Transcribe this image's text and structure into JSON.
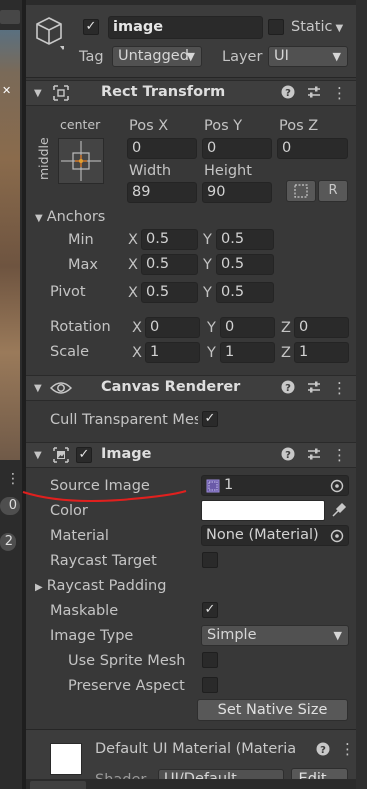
{
  "header": {
    "object_name": "image",
    "static_label": "Static",
    "tag_label": "Tag",
    "tag_value": "Untagged",
    "layer_label": "Layer",
    "layer_value": "UI"
  },
  "rect_transform": {
    "title": "Rect Transform",
    "anchor_preset_h": "center",
    "anchor_preset_v": "middle",
    "pos_x_label": "Pos X",
    "pos_y_label": "Pos Y",
    "pos_z_label": "Pos Z",
    "pos_x": "0",
    "pos_y": "0",
    "pos_z": "0",
    "width_label": "Width",
    "height_label": "Height",
    "width": "89",
    "height": "90",
    "raw_label": "R",
    "anchors_label": "Anchors",
    "min_label": "Min",
    "max_label": "Max",
    "pivot_label": "Pivot",
    "x_label": "X",
    "y_label": "Y",
    "z_label": "Z",
    "min_x": "0.5",
    "min_y": "0.5",
    "max_x": "0.5",
    "max_y": "0.5",
    "pivot_x": "0.5",
    "pivot_y": "0.5",
    "rotation_label": "Rotation",
    "rot_x": "0",
    "rot_y": "0",
    "rot_z": "0",
    "scale_label": "Scale",
    "scale_x": "1",
    "scale_y": "1",
    "scale_z": "1"
  },
  "canvas_renderer": {
    "title": "Canvas Renderer",
    "cull_label": "Cull Transparent Mes",
    "cull_checked": true
  },
  "image": {
    "title": "Image",
    "source_image_label": "Source Image",
    "source_image_value": "1",
    "color_label": "Color",
    "color_value": "#ffffff",
    "material_label": "Material",
    "material_value": "None (Material)",
    "raycast_target_label": "Raycast Target",
    "raycast_padding_label": "Raycast Padding",
    "maskable_label": "Maskable",
    "image_type_label": "Image Type",
    "image_type_value": "Simple",
    "use_sprite_mesh_label": "Use Sprite Mesh",
    "preserve_aspect_label": "Preserve Aspect",
    "set_native_size_label": "Set Native Size"
  },
  "material_preview": {
    "title": "Default UI Material (Materia",
    "shader_label": "Shader",
    "shader_value": "UI/Default",
    "edit_label": "Edit..."
  },
  "left_panel": {
    "number_a": "0",
    "number_b": "2"
  },
  "colors": {
    "annotation": "#e0201e",
    "accent": "#4c7fd8"
  }
}
